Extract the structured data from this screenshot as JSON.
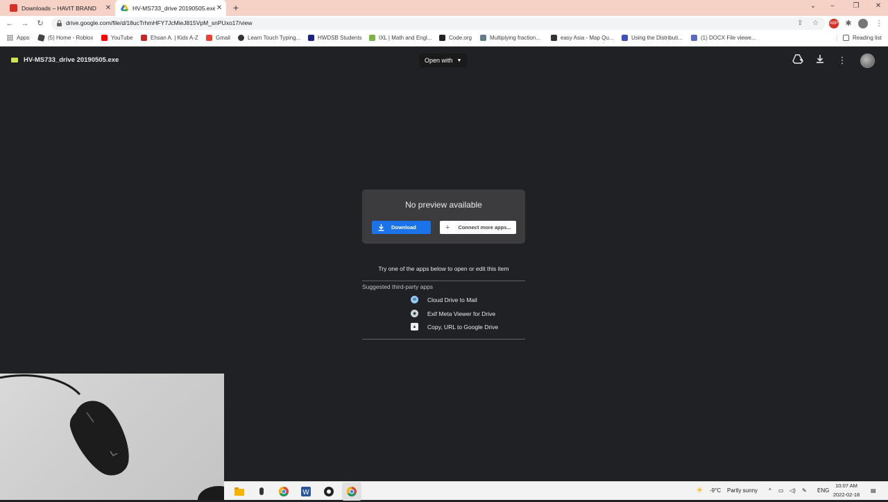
{
  "browser": {
    "tabs": [
      {
        "title": "Downloads – HAVIT BRAND",
        "favicon_color": "#d93025"
      },
      {
        "title": "HV-MS733_drive 20190505.exe",
        "favicon_color": "#1a73e8"
      }
    ],
    "new_tab_label": "+",
    "url": "drive.google.com/file/d/18ucTrhmHFY7JcMieJ815VpM_snPUxo17/view",
    "reading_list": "Reading list"
  },
  "bookmarks": [
    {
      "label": "Apps",
      "icon": "apps-grid-icon"
    },
    {
      "label": "(5) Home - Roblox",
      "icon": "roblox-icon",
      "color": "#444"
    },
    {
      "label": "YouTube",
      "icon": "youtube-icon",
      "color": "#ff0000"
    },
    {
      "label": "Ehsan A. | Kids A-Z",
      "icon": "kids-az-icon",
      "color": "#c62828"
    },
    {
      "label": "Gmail",
      "icon": "gmail-icon",
      "color": "#ea4335"
    },
    {
      "label": "Learn Touch Typing...",
      "icon": "typing-icon",
      "color": "#333"
    },
    {
      "label": "HWDSB Students",
      "icon": "hwdsb-icon",
      "color": "#1a237e"
    },
    {
      "label": "IXL | Math and Engl...",
      "icon": "ixl-icon",
      "color": "#7cb342"
    },
    {
      "label": "Code.org",
      "icon": "code-org-icon",
      "color": "#222"
    },
    {
      "label": "Multiplying fraction...",
      "icon": "fraction-icon",
      "color": "#607d8b"
    },
    {
      "label": "easy Asia - Map Qu...",
      "icon": "map-quiz-icon",
      "color": "#333"
    },
    {
      "label": "Using the Distributi...",
      "icon": "distributive-icon",
      "color": "#3f51b5"
    },
    {
      "label": "(1) DOCX File viewe...",
      "icon": "teams-icon",
      "color": "#5c6bc0"
    }
  ],
  "viewer": {
    "file_name": "HV-MS733_drive 20190505.exe",
    "open_with": "Open with",
    "no_preview": "No preview available",
    "download": "Download",
    "connect_more": "Connect more apps...",
    "try_text": "Try one of the apps below to open or edit this item",
    "suggested_heading": "Suggested third-party apps",
    "apps": [
      {
        "name": "Cloud Drive to Mail",
        "icon": "cloud-mail-icon"
      },
      {
        "name": "Exif Meta Viewer for Drive",
        "icon": "exif-viewer-icon"
      },
      {
        "name": "Copy, URL to Google Drive",
        "icon": "url-drive-icon"
      }
    ]
  },
  "taskbar": {
    "weather_temp": "-9°C",
    "weather_desc": "Partly sunny",
    "language": "ENG",
    "time": "10:07 AM",
    "date": "2022-02-18"
  },
  "colors": {
    "tabstrip": "#f6d2c6",
    "viewer_bg": "#202124",
    "download_blue": "#1a73e8",
    "file_icon": "#d5e34e"
  }
}
